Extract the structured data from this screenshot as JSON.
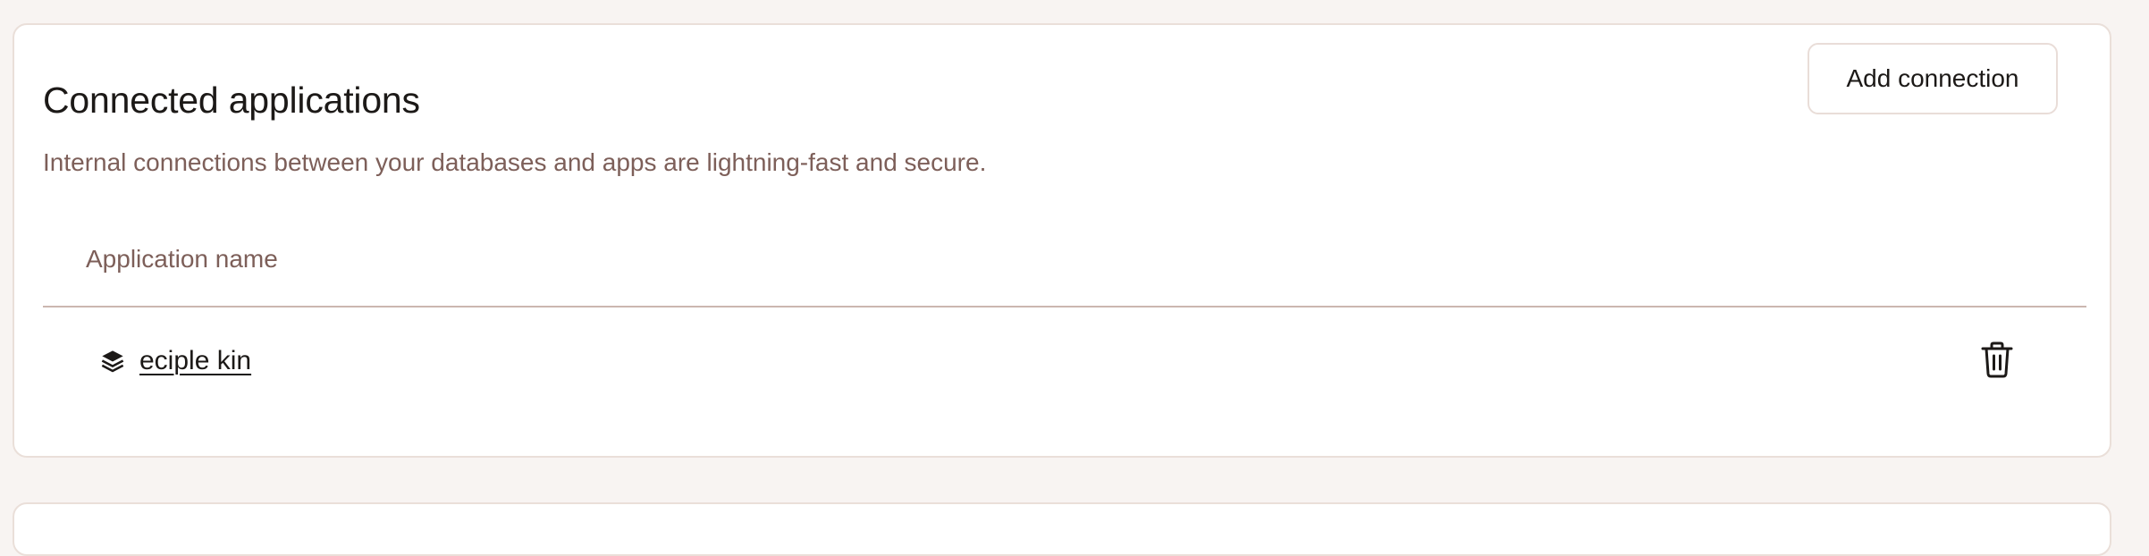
{
  "connections": {
    "title": "Connected applications",
    "description": "Internal connections between your databases and apps are lightning-fast and secure.",
    "add_button_label": "Add connection",
    "table": {
      "columns": [
        "Application name"
      ],
      "rows": [
        {
          "name": "eciple kin",
          "icon": "stack-icon",
          "action_icon": "trash-icon"
        }
      ]
    }
  }
}
